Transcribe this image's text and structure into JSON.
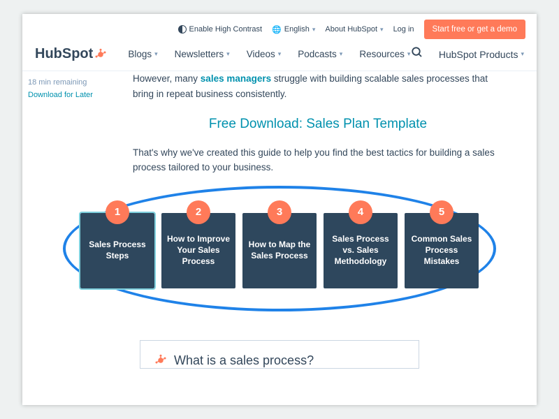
{
  "utilbar": {
    "contrast": "Enable High Contrast",
    "language": "English",
    "about": "About HubSpot",
    "login": "Log in",
    "cta": "Start free or get a demo"
  },
  "logo": "HubSpot",
  "nav": {
    "items": [
      "Blogs",
      "Newsletters",
      "Videos",
      "Podcasts",
      "Resources"
    ],
    "products": "HubSpot Products"
  },
  "sidebar": {
    "remaining": "18 min remaining",
    "download": "Download for Later"
  },
  "article": {
    "p1a": "However, many ",
    "p1link": "sales managers",
    "p1b": " struggle with building scalable sales processes that bring in repeat business consistently.",
    "freedl": "Free Download: Sales Plan Template",
    "p2": "That's why we've created this guide to help you find the best tactics for building a sales process tailored to your business."
  },
  "cards": [
    {
      "num": "1",
      "label": "Sales Process Steps"
    },
    {
      "num": "2",
      "label": "How to Improve Your Sales Process"
    },
    {
      "num": "3",
      "label": "How to Map the Sales Process"
    },
    {
      "num": "4",
      "label": "Sales Process vs. Sales Methodology"
    },
    {
      "num": "5",
      "label": "Common Sales Process Mistakes"
    }
  ],
  "panel": {
    "heading": "What is a sales process?"
  }
}
